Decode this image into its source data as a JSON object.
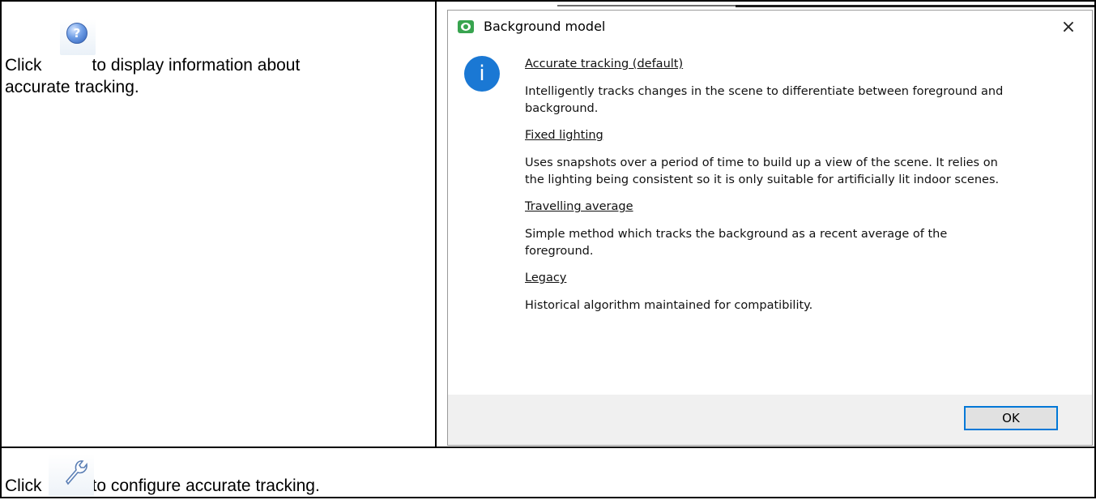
{
  "left_cell": {
    "line1_before": "Click",
    "line1_after": "to display information about",
    "line2": "accurate tracking.",
    "icon": "help-icon"
  },
  "bottom_cell": {
    "before": "Click",
    "after": "to configure accurate tracking.",
    "icon": "wrench-icon"
  },
  "dialog": {
    "title": "Background model",
    "close_glyph": "×",
    "info_glyph": "i",
    "sections": [
      {
        "heading": "Accurate tracking (default)",
        "lines": [
          "Intelligently tracks changes in the scene to differentiate between foreground and",
          "background."
        ]
      },
      {
        "heading": "Fixed lighting",
        "lines": [
          "Uses snapshots over a period of time to build up a view of the scene. It relies on",
          "the lighting being consistent so it is only suitable for artificially lit indoor scenes."
        ]
      },
      {
        "heading": "Travelling average",
        "lines": [
          "Simple method which tracks the background as a recent average of the",
          "foreground."
        ]
      },
      {
        "heading": "Legacy",
        "lines": [
          "Historical algorithm maintained for compatibility."
        ]
      }
    ],
    "ok_label": "OK",
    "accent_color": "#1a78d4",
    "app_icon_color": "#38a44f"
  }
}
